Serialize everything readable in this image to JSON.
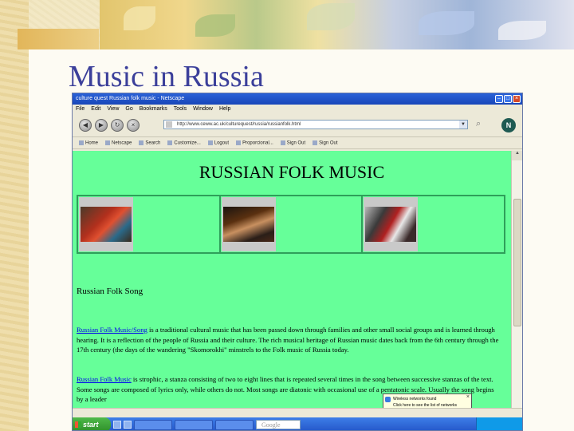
{
  "slide": {
    "title": "Music in Russia"
  },
  "browser": {
    "window_title": "culture quest Russian folk music - Netscape",
    "menu": [
      "File",
      "Edit",
      "View",
      "Go",
      "Bookmarks",
      "Tools",
      "Window",
      "Help"
    ],
    "url": "http://www.ceww.ac.uk/culturequest/russia/russianfolk.html",
    "personal_toolbar": [
      "Home",
      "Netscape",
      "Search",
      "Customize...",
      "Logout",
      "Proporcional...",
      "Sign Out",
      "Sign Out"
    ],
    "logo_letter": "N"
  },
  "page": {
    "heading": "RUSSIAN FOLK MUSIC",
    "subheading": "Russian Folk  Song",
    "para1_link": "Russian Folk Music/Song",
    "para1_text": " is a traditional cultural music that has been passed down through families and other small social groups and is learned through hearing.  It is a reflection of the people of Russia and their culture. The rich musical heritage of Russian music dates back from the 6th century through the 17th century (the days of the wandering \"Skomorokhi\" minstrels to the Folk music of Russia today.",
    "para2_link": "Russian Folk Music",
    "para2_text": " is strophic, a stanza consisting of two to eight lines that is repeated several times in the song between successive stanzas of the text. Some songs are composed of lyrics only, while others do not. Most songs are diatonic with occasional use of a pentatonic scale. Usually the song  begins by a leader"
  },
  "popup": {
    "title": "Wireless networks found",
    "text": "Click here to see the list of networks"
  },
  "taskbar": {
    "start": "start",
    "search_box": "Google"
  },
  "colors": {
    "page_background": "#66ff99",
    "slide_title": "#3b3f9a",
    "link": "#0000ee"
  }
}
